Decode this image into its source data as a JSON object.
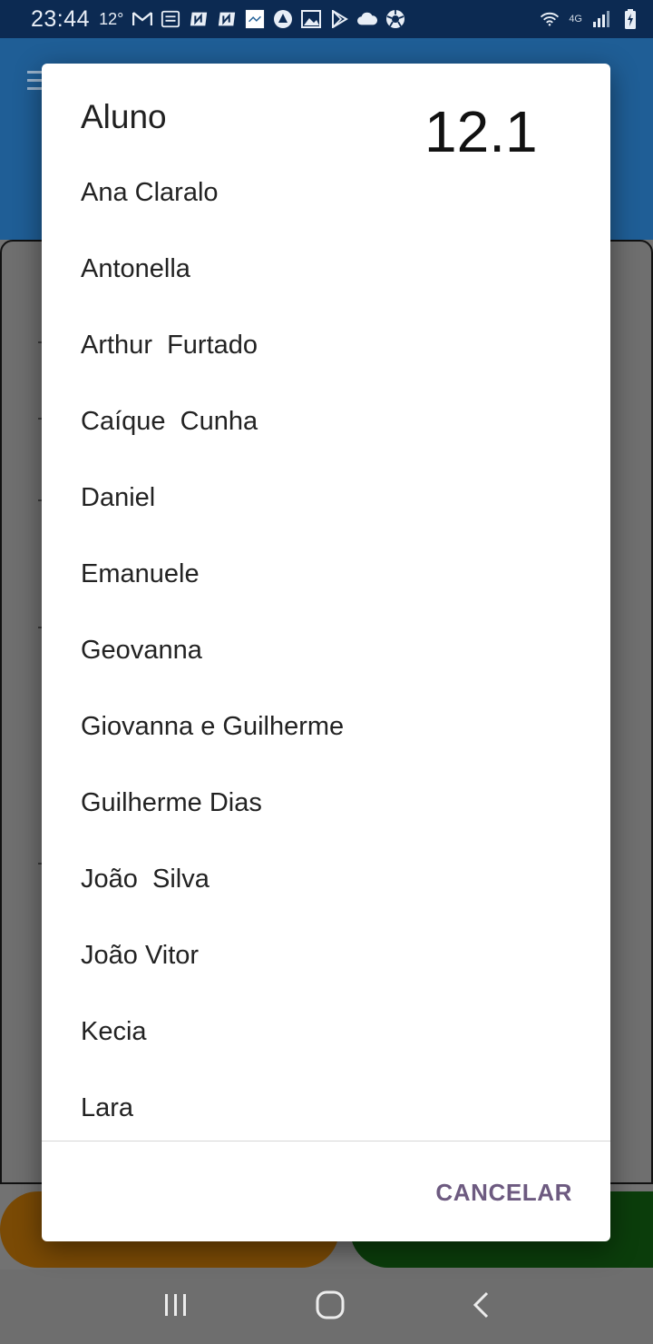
{
  "status_bar": {
    "time": "23:44",
    "temp": "12°",
    "network": "4G",
    "icons": [
      "gmail-icon",
      "flu-fans-icon",
      "app-icon",
      "app-icon",
      "image-app-icon",
      "compass-icon",
      "gallery-icon",
      "play-store-icon",
      "cloud-icon",
      "soccer-ball-icon"
    ]
  },
  "dialog": {
    "title": "Aluno",
    "badge": "12.1",
    "students": [
      "Ana Claralo",
      "Antonella",
      "Arthur  Furtado",
      "Caíque  Cunha",
      "Daniel",
      "Emanuele",
      "Geovanna",
      "Giovanna e Guilherme",
      "Guilherme Dias",
      "João  Silva",
      "João Vitor",
      "Kecia",
      "Lara"
    ],
    "cancel_label": "CANCELAR"
  },
  "colors": {
    "status_bar": "#0c2a52",
    "app_bar": "#1f5e96",
    "cancel_text": "#6d5a80",
    "left_button": "#7a4a05",
    "right_button": "#0b3d0b"
  }
}
